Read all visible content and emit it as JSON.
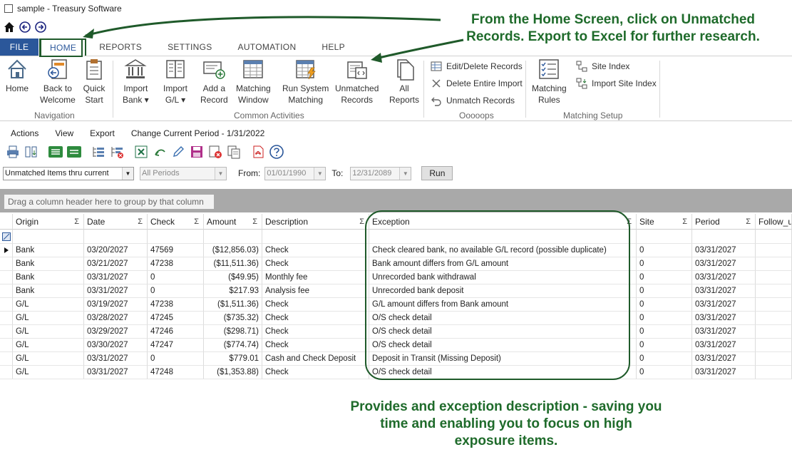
{
  "window": {
    "title": "sample - Treasury Software"
  },
  "tabs": [
    "FILE",
    "HOME",
    "REPORTS",
    "SETTINGS",
    "AUTOMATION",
    "HELP"
  ],
  "ribbon": {
    "home": "Home",
    "back_to_welcome_1": "Back to",
    "back_to_welcome_2": "Welcome",
    "quick_start_1": "Quick",
    "quick_start_2": "Start",
    "nav_group": "Navigation",
    "import_bank_1": "Import",
    "import_bank_2": "Bank ▾",
    "import_gl_1": "Import",
    "import_gl_2": "G/L ▾",
    "add_record_1": "Add a",
    "add_record_2": "Record",
    "matching_window_1": "Matching",
    "matching_window_2": "Window",
    "run_matching_1": "Run System",
    "run_matching_2": "Matching",
    "unmatched_1": "Unmatched",
    "unmatched_2": "Records",
    "all_reports_1": "All",
    "all_reports_2": "Reports",
    "common_group": "Common Activities",
    "edit_delete": "Edit/Delete Records",
    "delete_import": "Delete Entire Import",
    "unmatch": "Unmatch Records",
    "oops_group": "Ooooops",
    "matching_rules_1": "Matching",
    "matching_rules_2": "Rules",
    "site_index": "Site Index",
    "import_site_index": "Import Site Index",
    "setup_group": "Matching Setup"
  },
  "menu": [
    "Actions",
    "View",
    "Export",
    "Change Current Period - 1/31/2022"
  ],
  "filters": {
    "report_select": "Unmatched Items thru current",
    "period_select": "All Periods",
    "from_label": "From:",
    "from_value": "01/01/1990",
    "to_label": "To:",
    "to_value": "12/31/2089",
    "run": "Run"
  },
  "group_hint": "Drag a column header here to group by that column",
  "columns": [
    "Origin",
    "Date",
    "Check",
    "Amount",
    "Description",
    "Exception",
    "Site",
    "Period",
    "Follow_u"
  ],
  "rows": [
    [
      "Bank",
      "03/20/2027",
      "47569",
      "($12,856.03)",
      "Check",
      "Check cleared bank, no available G/L record (possible duplicate)",
      "0",
      "03/31/2027"
    ],
    [
      "Bank",
      "03/21/2027",
      "47238",
      "($11,511.36)",
      "Check",
      "Bank amount differs from G/L amount",
      "0",
      "03/31/2027"
    ],
    [
      "Bank",
      "03/31/2027",
      "0",
      "($49.95)",
      "Monthly fee",
      "Unrecorded bank withdrawal",
      "0",
      "03/31/2027"
    ],
    [
      "Bank",
      "03/31/2027",
      "0",
      "$217.93",
      "Analysis fee",
      "Unrecorded bank deposit",
      "0",
      "03/31/2027"
    ],
    [
      "G/L",
      "03/19/2027",
      "47238",
      "($1,511.36)",
      "Check",
      "G/L amount differs from Bank amount",
      "0",
      "03/31/2027"
    ],
    [
      "G/L",
      "03/28/2027",
      "47245",
      "($735.32)",
      "Check",
      "O/S check detail",
      "0",
      "03/31/2027"
    ],
    [
      "G/L",
      "03/29/2027",
      "47246",
      "($298.71)",
      "Check",
      "O/S check detail",
      "0",
      "03/31/2027"
    ],
    [
      "G/L",
      "03/30/2027",
      "47247",
      "($774.74)",
      "Check",
      "O/S check detail",
      "0",
      "03/31/2027"
    ],
    [
      "G/L",
      "03/31/2027",
      "0",
      "$779.01",
      "Cash and Check Deposit",
      "Deposit in Transit (Missing Deposit)",
      "0",
      "03/31/2027"
    ],
    [
      "G/L",
      "03/31/2027",
      "47248",
      "($1,353.88)",
      "Check",
      "O/S check detail",
      "0",
      "03/31/2027"
    ]
  ],
  "callouts": {
    "top_1": "From the Home Screen, click on Unmatched",
    "top_2": "Records.  Export to Excel for further research.",
    "bottom_1": "Provides and exception description - saving you",
    "bottom_2": "time and enabling you to focus on high",
    "bottom_3": "exposure items."
  },
  "colors": {
    "accent": "#2b579a",
    "callout_green": "#1f6b2b"
  }
}
